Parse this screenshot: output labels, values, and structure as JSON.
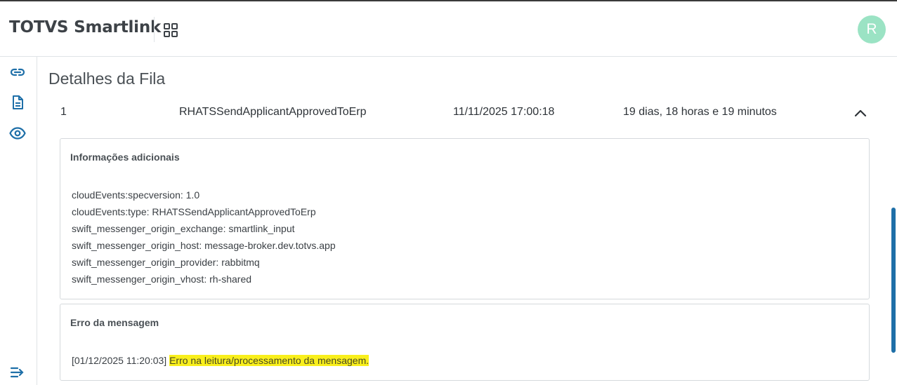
{
  "header": {
    "brand": "TOTVS Smartlink",
    "avatar_initial": "R",
    "avatar_color": "#9be3c4"
  },
  "sidebar": {
    "items": [
      {
        "icon": "link-icon"
      },
      {
        "icon": "document-icon"
      },
      {
        "icon": "eye-icon"
      }
    ],
    "collapse_icon": "collapse-menu-icon"
  },
  "main": {
    "title": "Detalhes da Fila",
    "row": {
      "index": "1",
      "event": "RHATSSendApplicantApprovedToErp",
      "datetime": "11/11/2025 17:00:18",
      "elapsed": "19 dias, 18 horas e 19 minutos"
    },
    "info_panel": {
      "title": "Informações adicionais",
      "lines": [
        "cloudEvents:specversion: 1.0",
        "cloudEvents:type: RHATSSendApplicantApprovedToErp",
        "swift_messenger_origin_exchange: smartlink_input",
        "swift_messenger_origin_host: message-broker.dev.totvs.app",
        "swift_messenger_origin_provider: rabbitmq",
        "swift_messenger_origin_vhost: rh-shared"
      ]
    },
    "error_panel": {
      "title": "Erro da mensagem",
      "timestamp": "[01/12/2025 11:20:03]",
      "message": "Erro na leitura/processamento da mensagem.",
      "highlight_color": "#f9ef1c"
    }
  },
  "accent_color": "#1e6fa8"
}
